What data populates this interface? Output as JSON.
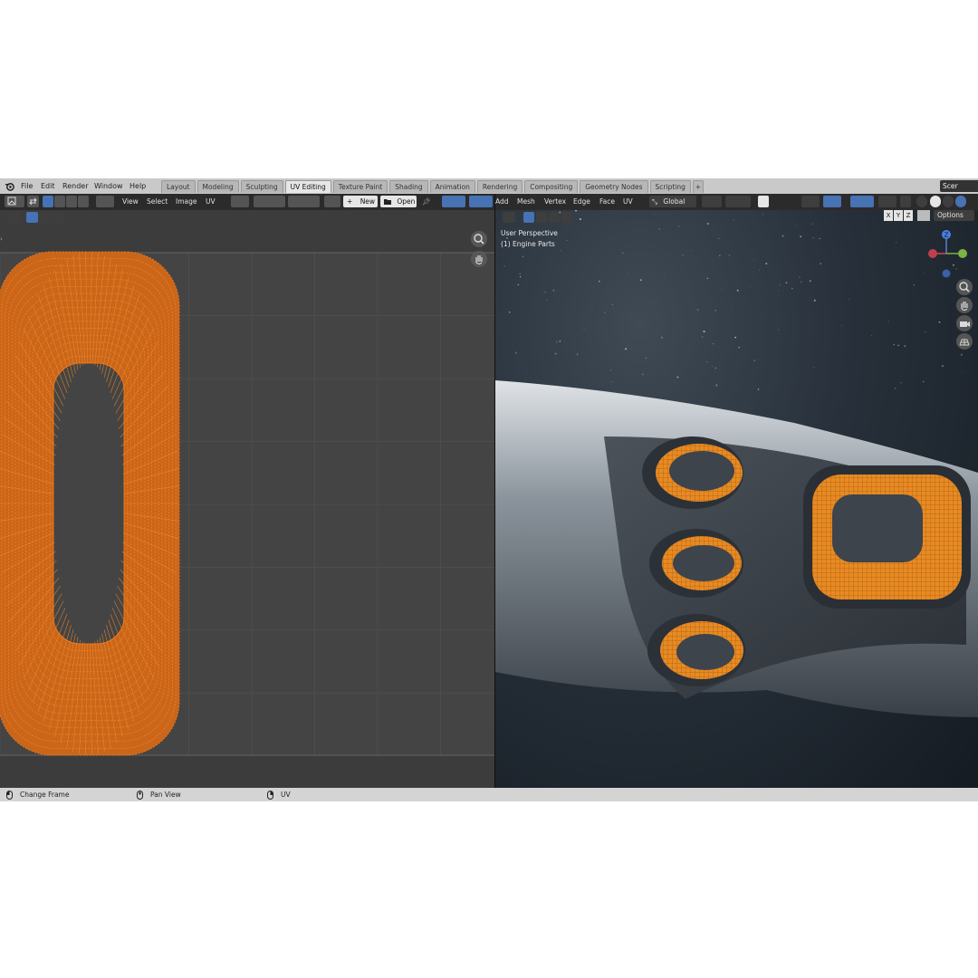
{
  "menubar": {
    "items": [
      "File",
      "Edit",
      "Render",
      "Window",
      "Help"
    ]
  },
  "workspaces": {
    "tabs": [
      "Layout",
      "Modeling",
      "Sculpting",
      "UV Editing",
      "Texture Paint",
      "Shading",
      "Animation",
      "Rendering",
      "Compositing",
      "Geometry Nodes",
      "Scripting"
    ],
    "active": "UV Editing",
    "add_label": "+"
  },
  "scene_label": "Scer",
  "uv_editor": {
    "menus": [
      "View",
      "Select",
      "Image",
      "UV"
    ],
    "new_label": "New",
    "open_label": "Open",
    "new_icon": "plus-icon",
    "open_icon": "folder-icon"
  },
  "viewport": {
    "menus": [
      "Add",
      "Mesh",
      "Vertex",
      "Edge",
      "Face",
      "UV"
    ],
    "orientation": "Global",
    "perspective_label": "User Perspective",
    "object_label": "(1) Engine Parts",
    "axis_buttons": [
      "X",
      "Y",
      "Z"
    ],
    "options_label": "Options",
    "gizmo_axis_z": "Z"
  },
  "statusbar": {
    "items": [
      "Change Frame",
      "Pan View",
      "UV"
    ]
  },
  "colors": {
    "accent": "#4772b3",
    "uv_selection": "#ff7a1a",
    "mesh_orange": "#e88a22"
  }
}
